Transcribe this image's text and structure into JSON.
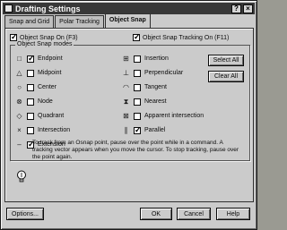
{
  "window": {
    "title": "Drafting Settings",
    "help_btn": "?",
    "close_btn": "×"
  },
  "tabs": [
    {
      "label": "Snap and Grid"
    },
    {
      "label": "Polar Tracking"
    },
    {
      "label": "Object Snap"
    }
  ],
  "top": {
    "osnap_on": {
      "label": "Object Snap On (F3)",
      "checked": true
    },
    "tracking_on": {
      "label": "Object Snap Tracking On (F11)",
      "checked": true
    }
  },
  "modes_title": "Object Snap modes",
  "modes_left": [
    {
      "label": "Endpoint",
      "checked": true,
      "icon": "endpoint-square"
    },
    {
      "label": "Midpoint",
      "checked": false,
      "icon": "midpoint-triangle"
    },
    {
      "label": "Center",
      "checked": false,
      "icon": "center-circle"
    },
    {
      "label": "Node",
      "checked": false,
      "icon": "node-crossed-circle"
    },
    {
      "label": "Quadrant",
      "checked": false,
      "icon": "quadrant-diamond"
    },
    {
      "label": "Intersection",
      "checked": false,
      "icon": "intersection-x"
    },
    {
      "label": "Extension",
      "checked": true,
      "icon": "extension-dash"
    }
  ],
  "modes_right": [
    {
      "label": "Insertion",
      "checked": false,
      "icon": "insertion-box"
    },
    {
      "label": "Perpendicular",
      "checked": false,
      "icon": "perpendicular"
    },
    {
      "label": "Tangent",
      "checked": false,
      "icon": "tangent-circle"
    },
    {
      "label": "Nearest",
      "checked": false,
      "icon": "nearest-hourglass"
    },
    {
      "label": "Apparent intersection",
      "checked": false,
      "icon": "apparent-intersection"
    },
    {
      "label": "Parallel",
      "checked": true,
      "icon": "parallel"
    }
  ],
  "buttons": {
    "select_all": "Select All",
    "clear_all": "Clear All"
  },
  "info_text": "To track from an Osnap point, pause over the point while in a command. A tracking vector appears when you move the cursor. To stop tracking, pause over the point again.",
  "footer": {
    "options": "Options...",
    "ok": "OK",
    "cancel": "Cancel",
    "help": "Help"
  }
}
